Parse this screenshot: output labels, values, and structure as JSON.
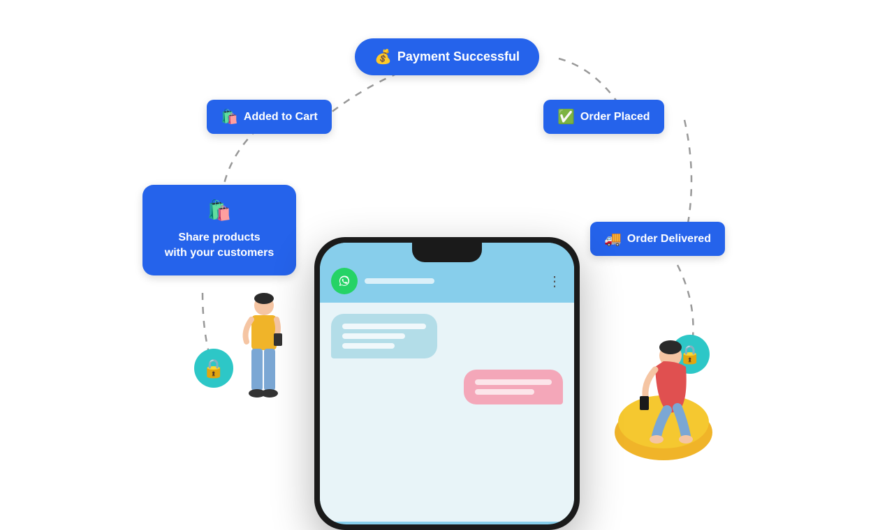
{
  "badges": {
    "payment": {
      "label": "Payment Successful",
      "icon": "💰"
    },
    "cart": {
      "label": "Added to Cart",
      "icon": "🛍️"
    },
    "order_placed": {
      "label": "Order Placed",
      "icon": "✅"
    },
    "share": {
      "label": "Share products\nwith your customers",
      "line1": "Share products",
      "line2": "with your customers",
      "icon": "🛍️"
    },
    "delivered": {
      "label": "Order Delivered",
      "icon": "🚚"
    }
  },
  "phone": {
    "whatsapp_color": "#25D366",
    "bubble_received_color": "#b3dde8",
    "bubble_sent_color": "#F4A7B9"
  },
  "colors": {
    "badge_blue": "#2563EB",
    "lock_teal": "#2DC7C7",
    "accent": "#F9C912"
  }
}
